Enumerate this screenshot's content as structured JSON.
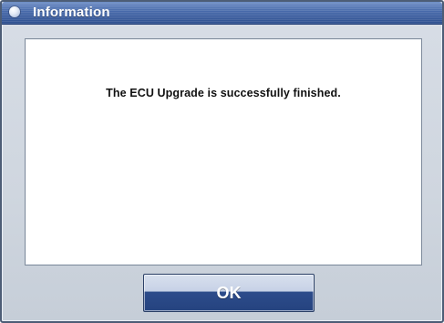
{
  "window": {
    "title": "Information",
    "title_icon": "info-bullet-icon"
  },
  "content": {
    "message": "The ECU Upgrade is successfully finished."
  },
  "buttons": {
    "ok_label": "OK"
  },
  "colors": {
    "titlebar": "#4668a9",
    "dialog_bg": "#cfd6df",
    "content_bg": "#ffffff",
    "button_bottom": "#25437f",
    "text": "#111111"
  }
}
